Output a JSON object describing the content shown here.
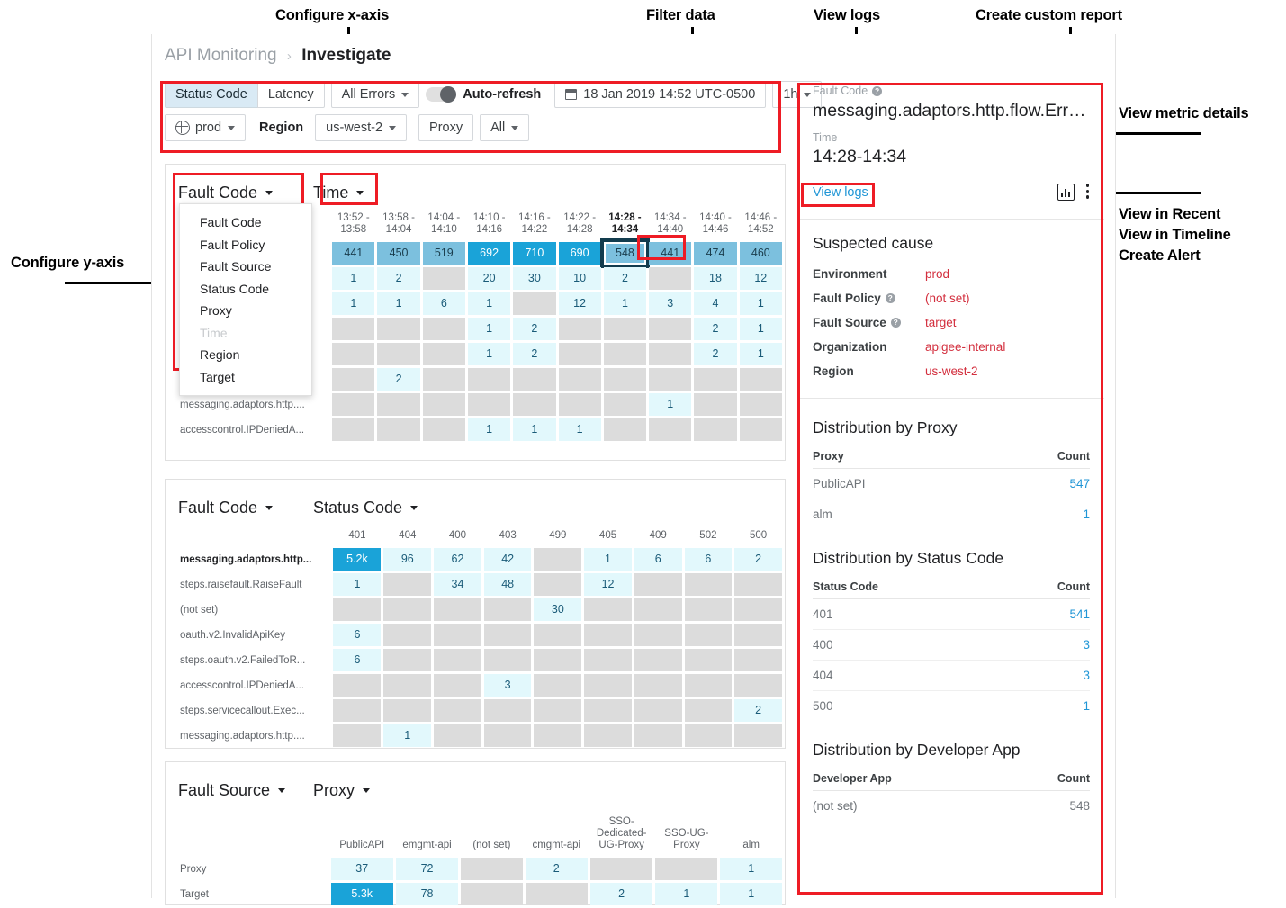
{
  "annotations": [
    {
      "id": "configure-x-axis",
      "text": "Configure x-axis"
    },
    {
      "id": "filter-data",
      "text": "Filter data"
    },
    {
      "id": "view-logs",
      "text": "View logs"
    },
    {
      "id": "create-custom-report",
      "text": "Create custom report"
    },
    {
      "id": "view-metric-details",
      "text": "View metric details"
    },
    {
      "id": "view-in-recent",
      "text": "View in Recent"
    },
    {
      "id": "view-in-timeline",
      "text": "View in Timeline"
    },
    {
      "id": "create-alert",
      "text": "Create Alert"
    },
    {
      "id": "configure-y-axis",
      "text": "Configure y-axis"
    }
  ],
  "breadcrumb": {
    "parent": "API Monitoring",
    "separator": "›",
    "current": "Investigate"
  },
  "toolbar": {
    "status_code": "Status Code",
    "latency": "Latency",
    "all_errors": "All Errors",
    "auto_refresh": "Auto-refresh",
    "date_range": "18 Jan 2019 14:52 UTC-0500",
    "duration": "1h",
    "environment": "prod",
    "region_label": "Region",
    "region_value": "us-west-2",
    "proxy_label": "Proxy",
    "proxy_value": "All"
  },
  "ydropdown": {
    "selected": "Fault Code",
    "options": [
      {
        "label": "Fault Code",
        "disabled": false
      },
      {
        "label": "Fault Policy",
        "disabled": false
      },
      {
        "label": "Fault Source",
        "disabled": false
      },
      {
        "label": "Status Code",
        "disabled": false
      },
      {
        "label": "Proxy",
        "disabled": false
      },
      {
        "label": "Time",
        "disabled": true
      },
      {
        "label": "Region",
        "disabled": false
      },
      {
        "label": "Target",
        "disabled": false
      }
    ]
  },
  "chart_data": [
    {
      "type": "heatmap",
      "title": "Fault Code by Time",
      "yaxis_selector": "Fault Code",
      "xaxis_selector": "Time",
      "xlabel": "Time",
      "ylabel": "Fault Code",
      "categories": [
        "13:52 -\n13:58",
        "13:58 -\n14:04",
        "14:04 -\n14:10",
        "14:10 -\n14:16",
        "14:16 -\n14:22",
        "14:22 -\n14:28",
        "14:28 -\n14:34",
        "14:34 -\n14:40",
        "14:40 -\n14:46",
        "14:46 -\n14:52"
      ],
      "selected_category": "14:28 -\n14:34",
      "rows": [
        {
          "label": "",
          "values": [
            441,
            450,
            519,
            692,
            710,
            690,
            548,
            441,
            474,
            460
          ]
        },
        {
          "label": "",
          "values": [
            1,
            2,
            null,
            20,
            30,
            10,
            2,
            null,
            18,
            12
          ]
        },
        {
          "label": "",
          "values": [
            1,
            1,
            6,
            1,
            null,
            12,
            1,
            3,
            4,
            1
          ]
        },
        {
          "label": "",
          "values": [
            null,
            null,
            null,
            1,
            2,
            null,
            null,
            null,
            2,
            1
          ]
        },
        {
          "label": "",
          "values": [
            null,
            null,
            null,
            1,
            2,
            null,
            null,
            null,
            2,
            1
          ]
        },
        {
          "label": "",
          "values": [
            null,
            2,
            null,
            null,
            null,
            null,
            null,
            null,
            null,
            null
          ]
        },
        {
          "label": "messaging.adaptors.http....",
          "values": [
            null,
            null,
            null,
            null,
            null,
            null,
            null,
            1,
            null,
            null
          ]
        },
        {
          "label": "accesscontrol.IPDeniedA...",
          "values": [
            null,
            null,
            null,
            1,
            1,
            1,
            null,
            null,
            null,
            null
          ]
        }
      ],
      "selected_cell": {
        "row": 0,
        "col": 6,
        "value": 548
      },
      "highlighted_cell": {
        "row": 0,
        "col": 7,
        "value": 441
      }
    },
    {
      "type": "heatmap",
      "title": "Fault Code by Status Code",
      "yaxis_selector": "Fault Code",
      "xaxis_selector": "Status Code",
      "xlabel": "Status Code",
      "ylabel": "Fault Code",
      "categories": [
        "401",
        "404",
        "400",
        "403",
        "499",
        "405",
        "409",
        "502",
        "500"
      ],
      "rows": [
        {
          "label": "messaging.adaptors.http...",
          "bold": true,
          "values": [
            "5.2k",
            96,
            62,
            42,
            null,
            1,
            6,
            6,
            2
          ]
        },
        {
          "label": "steps.raisefault.RaiseFault",
          "values": [
            1,
            null,
            34,
            48,
            null,
            12,
            null,
            null,
            null
          ]
        },
        {
          "label": "(not set)",
          "values": [
            null,
            null,
            null,
            null,
            30,
            null,
            null,
            null,
            null
          ]
        },
        {
          "label": "oauth.v2.InvalidApiKey",
          "values": [
            6,
            null,
            null,
            null,
            null,
            null,
            null,
            null,
            null
          ]
        },
        {
          "label": "steps.oauth.v2.FailedToR...",
          "values": [
            6,
            null,
            null,
            null,
            null,
            null,
            null,
            null,
            null
          ]
        },
        {
          "label": "accesscontrol.IPDeniedA...",
          "values": [
            null,
            null,
            null,
            3,
            null,
            null,
            null,
            null,
            null
          ]
        },
        {
          "label": "steps.servicecallout.Exec...",
          "values": [
            null,
            null,
            null,
            null,
            null,
            null,
            null,
            null,
            2
          ]
        },
        {
          "label": "messaging.adaptors.http....",
          "values": [
            null,
            1,
            null,
            null,
            null,
            null,
            null,
            null,
            null
          ]
        }
      ]
    },
    {
      "type": "heatmap",
      "title": "Fault Source by Proxy",
      "yaxis_selector": "Fault Source",
      "xaxis_selector": "Proxy",
      "xlabel": "Proxy",
      "ylabel": "Fault Source",
      "categories": [
        "PublicAPI",
        "emgmt-api",
        "(not set)",
        "cmgmt-api",
        "SSO-\nDedicated-\nUG-Proxy",
        "SSO-UG-\nProxy",
        "alm"
      ],
      "rows": [
        {
          "label": "Proxy",
          "values": [
            37,
            72,
            null,
            2,
            null,
            null,
            1
          ]
        },
        {
          "label": "Target",
          "values": [
            "5.3k",
            78,
            null,
            null,
            2,
            1,
            1
          ]
        }
      ]
    }
  ],
  "detail": {
    "fault_code_label": "Fault Code",
    "fault_code_value": "messaging.adaptors.http.flow.ErrorRe...",
    "time_label": "Time",
    "time_value": "14:28-14:34",
    "view_logs": "View logs",
    "suspected_cause_title": "Suspected cause",
    "suspected_cause": [
      {
        "key": "Environment",
        "value": "prod",
        "help": false
      },
      {
        "key": "Fault Policy",
        "value": "(not set)",
        "help": true
      },
      {
        "key": "Fault Source",
        "value": "target",
        "help": true
      },
      {
        "key": "Organization",
        "value": "apigee-internal",
        "help": false
      },
      {
        "key": "Region",
        "value": "us-west-2",
        "help": false
      }
    ],
    "dist_proxy": {
      "title": "Distribution by Proxy",
      "columns": [
        "Proxy",
        "Count"
      ],
      "rows": [
        {
          "name": "PublicAPI",
          "count": "547",
          "link": true
        },
        {
          "name": "alm",
          "count": "1",
          "link": true
        }
      ]
    },
    "dist_status": {
      "title": "Distribution by Status Code",
      "columns": [
        "Status Code",
        "Count"
      ],
      "rows": [
        {
          "name": "401",
          "count": "541",
          "link": true
        },
        {
          "name": "400",
          "count": "3",
          "link": true
        },
        {
          "name": "404",
          "count": "3",
          "link": true
        },
        {
          "name": "500",
          "count": "1",
          "link": true
        }
      ]
    },
    "dist_app": {
      "title": "Distribution by Developer App",
      "columns": [
        "Developer App",
        "Count"
      ],
      "rows": [
        {
          "name": "(not set)",
          "count": "548",
          "link": false
        }
      ]
    }
  },
  "colors": {
    "accent_blue": "#1aa3d8",
    "mid_blue": "#7cc0de",
    "pale_blue": "#e2f8fc",
    "empty_grey": "#dcdcdc",
    "annotation_red": "#ee1c25",
    "suspect_red": "#d32f3e",
    "link_blue": "#2196d6"
  }
}
